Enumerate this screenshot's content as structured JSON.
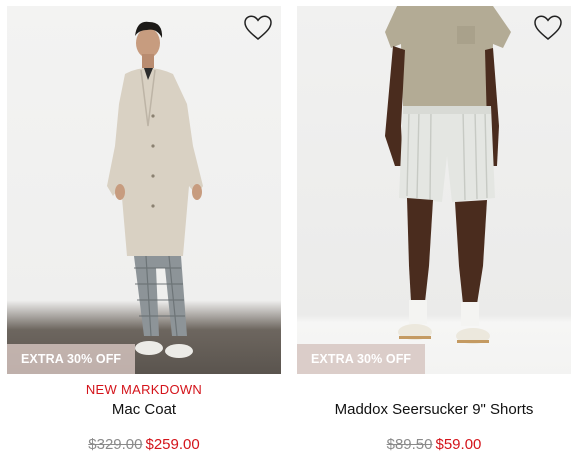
{
  "products": [
    {
      "name": "Mac Coat",
      "tag": "NEW MARKDOWN",
      "badge": "EXTRA 30% OFF",
      "price_original": "$329.00",
      "price_sale": "$259.00",
      "wishlist_icon": "heart-outline-icon"
    },
    {
      "name": "Maddox Seersucker 9\" Shorts",
      "tag": "",
      "badge": "EXTRA 30% OFF",
      "price_original": "$89.50",
      "price_sale": "$59.00",
      "wishlist_icon": "heart-outline-icon"
    }
  ],
  "colors": {
    "sale": "#d4141b",
    "strike": "#8b8b8b",
    "badge_bg": "#d6c4c0"
  }
}
